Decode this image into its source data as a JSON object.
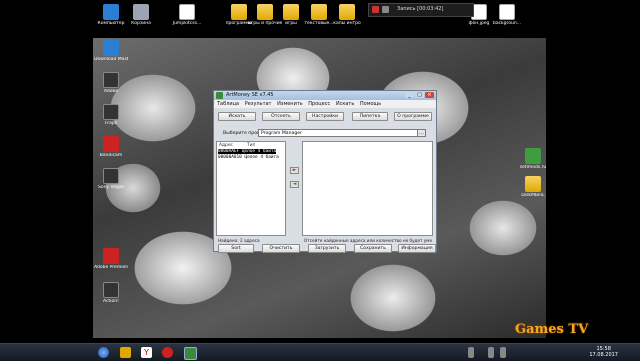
{
  "desktop_top_icons": [
    {
      "name": "computer",
      "label": "Компьютер",
      "color": "#3a7bd5"
    },
    {
      "name": "recycle",
      "label": "Корзина",
      "color": "#9aa5b1"
    },
    {
      "name": "file1",
      "label": "Jumpkitcss...",
      "color": "#ffffff"
    },
    {
      "name": "programs",
      "label": "программы",
      "color": "#e0a800"
    },
    {
      "name": "games_prog",
      "label": "игры и прочие",
      "color": "#e0a800"
    },
    {
      "name": "games",
      "label": "игры",
      "color": "#e0a800"
    },
    {
      "name": "text",
      "label": "текстовые...",
      "color": "#e0a800"
    },
    {
      "name": "intro",
      "label": "капы интро",
      "color": "#e0a800"
    },
    {
      "name": "photo",
      "label": "фон.jpeg",
      "color": "#ffffff"
    },
    {
      "name": "background",
      "label": "backgroun...",
      "color": "#ffffff"
    }
  ],
  "desktop_left_icons": [
    {
      "label": "Download Master"
    },
    {
      "label": "Adobe"
    },
    {
      "label": "Fraps"
    },
    {
      "label": "Bandicam"
    },
    {
      "label": "Sony Vegas"
    },
    {
      "label": "Adobe Premiere"
    },
    {
      "label": "Action!"
    }
  ],
  "desktop_right_icons": [
    {
      "label": "setlmods.ru"
    },
    {
      "label": "DiskMBinL"
    }
  ],
  "recorder": {
    "title": "Запись [00:03:42]"
  },
  "window": {
    "title": "ArtMoney SE v7.45",
    "menu": [
      "Таблица",
      "Результат",
      "Изменить",
      "Процесс",
      "Искать",
      "Помощь"
    ],
    "toolbar": [
      "Искать",
      "Отсеять",
      "Настройки",
      "Пипетка",
      "О программе"
    ],
    "process_label": "Выберите процесс",
    "process_value": "Program Manager",
    "left_headers": [
      "Адрес",
      "Тип"
    ],
    "rows": [
      {
        "address": "0000AAEF",
        "type": "Целое 4 байта",
        "selected": true
      },
      {
        "address": "00000A810",
        "type": "Целое 4 байта",
        "selected": false
      }
    ],
    "status_left": "Найдено: 2 адреса",
    "status_right": "Отсейте найденные адреса или количество не будет уменьшаться",
    "bottom": [
      "Sort",
      "Очистить",
      "Загрузить",
      "Сохранить",
      "Информация"
    ]
  },
  "taskbar": {
    "time": "15:58",
    "date": "17.08.2017"
  },
  "watermark": "Games TV"
}
